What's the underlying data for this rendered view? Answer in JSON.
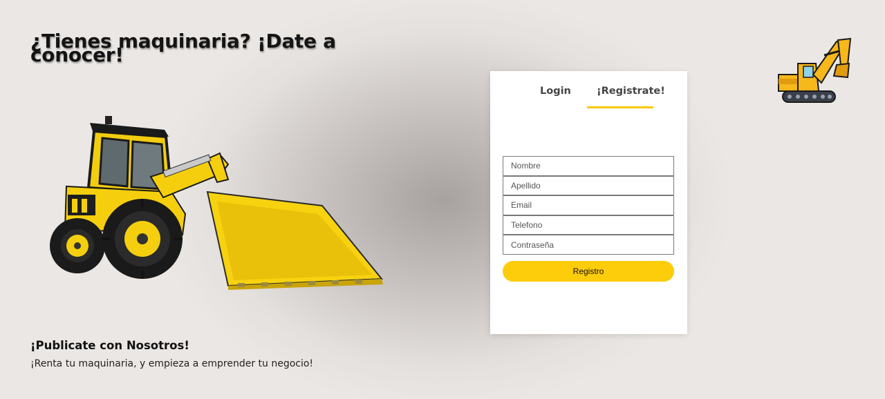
{
  "hero": {
    "headline": "¿Tienes maquinaria? ¡Date a conocer!",
    "promo_title": "¡Publicate con Nosotros!",
    "promo_text": "¡Renta tu maquinaria, y empieza a emprender tu negocio!"
  },
  "tabs": {
    "login_label": "Login",
    "register_label": "¡Registrate!",
    "active": "register"
  },
  "form": {
    "fields": [
      {
        "name": "nombre",
        "placeholder": "Nombre",
        "value": ""
      },
      {
        "name": "apellido",
        "placeholder": "Apellido",
        "value": ""
      },
      {
        "name": "email",
        "placeholder": "Email",
        "value": ""
      },
      {
        "name": "telefono",
        "placeholder": "Telefono",
        "value": ""
      },
      {
        "name": "contrasena",
        "placeholder": "Contraseña",
        "value": ""
      }
    ],
    "submit_label": "Registro"
  },
  "icons": {
    "hero_image": "wheel-loader-illustration",
    "logo": "excavator-icon"
  },
  "colors": {
    "accent": "#fdcc0a",
    "tab_underline": "#f7c800",
    "machine_yellow": "#f5cf0d"
  }
}
